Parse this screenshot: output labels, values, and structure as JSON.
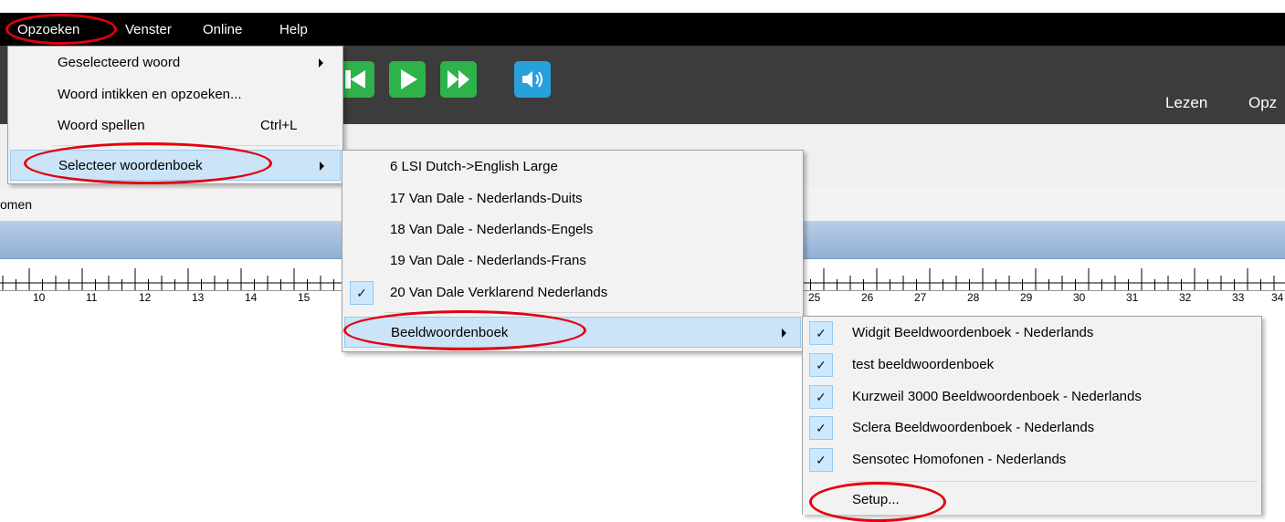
{
  "menubar": {
    "items": [
      "Opzoeken",
      "Venster",
      "Online",
      "Help"
    ]
  },
  "toolbar": {
    "lezen": "Lezen",
    "opzoeken_partial": "Opz"
  },
  "tabstrip": {
    "partial_label": "omen"
  },
  "ruler": {
    "left_numbers": [
      "10",
      "11",
      "12",
      "13",
      "14",
      "15"
    ],
    "right_numbers": [
      "25",
      "26",
      "27",
      "28",
      "29",
      "30",
      "31",
      "32",
      "33",
      "34"
    ]
  },
  "menu_opzoeken": {
    "geselecteerd": "Geselecteerd woord",
    "intikken": "Woord intikken en opzoeken...",
    "spellen": "Woord spellen",
    "spellen_shortcut": "Ctrl+L",
    "selecteer": "Selecteer woordenboek"
  },
  "menu_woordenboek": {
    "items": [
      "6 LSI Dutch->English Large",
      "17 Van Dale - Nederlands-Duits",
      "18 Van Dale - Nederlands-Engels",
      "19 Van Dale - Nederlands-Frans",
      "20 Van Dale Verklarend Nederlands"
    ],
    "beeld": "Beeldwoordenboek"
  },
  "menu_beeld": {
    "items": [
      "Widgit Beeldwoordenboek - Nederlands",
      "test beeldwoordenboek",
      "Kurzweil 3000 Beeldwoordenboek - Nederlands",
      "Sclera Beeldwoordenboek - Nederlands",
      "Sensotec Homofonen - Nederlands"
    ],
    "setup": "Setup..."
  },
  "colors": {
    "annotation_ring": "#e3000f",
    "play_green": "#2db34a",
    "volume_blue": "#27a0dc",
    "highlight": "#cce4f7"
  }
}
